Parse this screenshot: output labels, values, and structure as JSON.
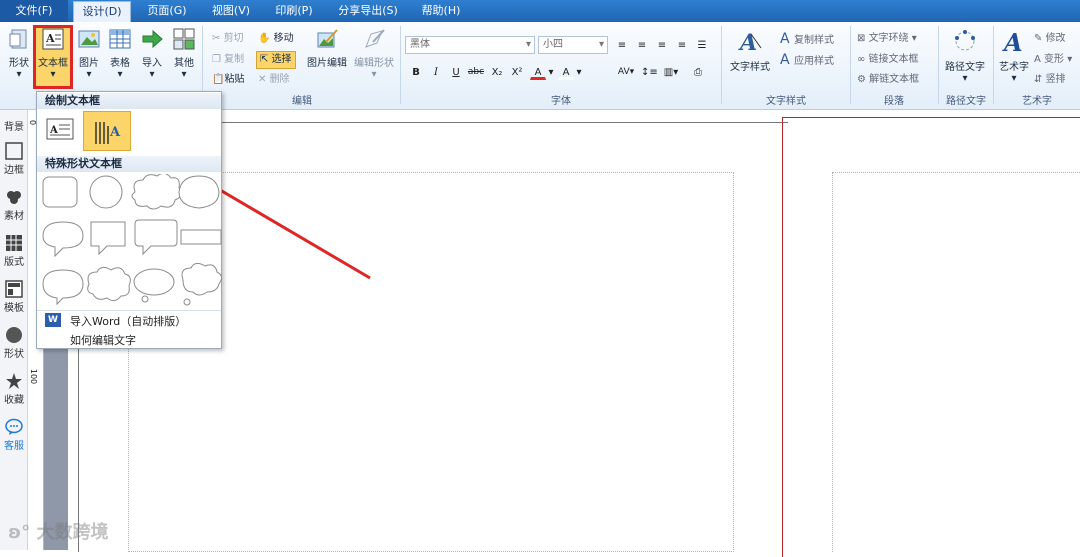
{
  "menubar": {
    "items": [
      "文件(F)",
      "设计(D)",
      "页面(G)",
      "视图(V)",
      "印刷(P)",
      "分享导出(S)",
      "帮助(H)"
    ],
    "active_index": 1
  },
  "ribbon": {
    "insert_group": {
      "buttons": [
        "形状",
        "文本框",
        "图片",
        "表格",
        "导入",
        "其他"
      ]
    },
    "edit_group": {
      "label": "编辑",
      "cut": "剪切",
      "move": "移动",
      "copy": "复制",
      "select": "选择",
      "paste": "粘贴",
      "delete": "删除",
      "image_edit": "图片编辑",
      "shape_edit": "编辑形状"
    },
    "font_group": {
      "label": "字体",
      "font_name": "黑体",
      "font_size": "小四",
      "format_buttons": [
        "B",
        "I",
        "U",
        "abc",
        "X₂",
        "X²",
        "A",
        "A"
      ]
    },
    "text_style_group": {
      "label": "文字样式",
      "main": "文字样式",
      "copy_style": "复制样式",
      "apply_style": "应用样式"
    },
    "paragraph_group": {
      "label": "段落",
      "wrap": "文字环绕",
      "link": "链接文本框",
      "unlink": "解链文本框"
    },
    "path_group": {
      "label": "路径文字",
      "main": "路径文字"
    },
    "art_group": {
      "label": "艺术字",
      "main": "艺术字",
      "modify": "修改",
      "transform": "变形",
      "vertical": "竖排"
    }
  },
  "sidebar": {
    "items": [
      "背景",
      "边框",
      "素材",
      "版式",
      "模板",
      "形状",
      "收藏",
      "客服"
    ]
  },
  "ruler": {
    "mark_0": "0",
    "mark_100": "100"
  },
  "dropdown": {
    "draw_header": "绘制文本框",
    "special_header": "特殊形状文本框",
    "import_word": "导入Word（自动排版）",
    "how_edit": "如何编辑文字"
  },
  "watermark": {
    "text": "大数跨境"
  },
  "colors": {
    "menu_blue": "#2270c2",
    "highlight": "#e02525",
    "selected_btn": "#fbd46a"
  }
}
